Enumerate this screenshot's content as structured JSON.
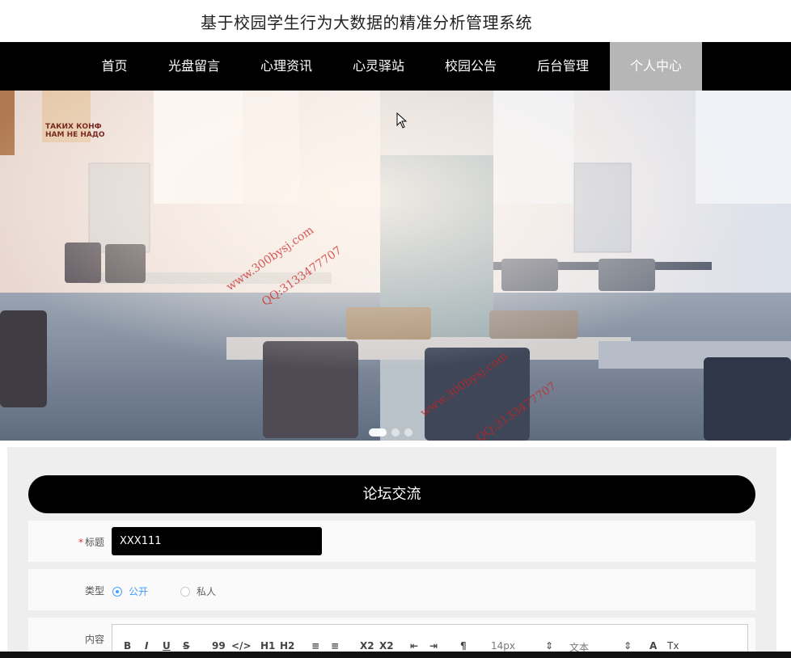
{
  "site": {
    "title": "基于校园学生行为大数据的精准分析管理系统"
  },
  "nav": {
    "items": [
      {
        "label": "首页"
      },
      {
        "label": "光盘留言"
      },
      {
        "label": "心理资讯"
      },
      {
        "label": "心灵驿站"
      },
      {
        "label": "校园公告"
      },
      {
        "label": "后台管理"
      },
      {
        "label": "个人中心"
      }
    ],
    "active_index": 6
  },
  "banner": {
    "image": "cafeteria-illustration",
    "poster_text_1": "ТАКИХ КОНФ",
    "poster_text_2": "НАМ НЕ НАДО",
    "watermarks": [
      "www.300bysj.com",
      "QQ:3133477707",
      "www.300bysj.com",
      "QQ:3133477707"
    ],
    "slide_count": 3,
    "active_slide": 0
  },
  "forum": {
    "header": "论坛交流",
    "title_label": "标题",
    "title_required": "*",
    "title_value": "XXX111",
    "type_label": "类型",
    "type_options": [
      {
        "label": "公开",
        "checked": true
      },
      {
        "label": "私人",
        "checked": false
      }
    ],
    "content_label": "内容",
    "toolbar": {
      "bold": "B",
      "italic": "I",
      "underline": "U",
      "strike": "S",
      "quote": "99",
      "code": "</>",
      "h1": "H1",
      "h2": "H2",
      "ordered_list": "≡",
      "bullet_list": "≡",
      "subscript": "X2",
      "superscript": "X2",
      "outdent": "⇤",
      "indent": "⇥",
      "direction": "¶",
      "size": "14px",
      "font": "文本",
      "color": "A",
      "clean": "Tx"
    }
  },
  "colors": {
    "nav_bg": "#000000",
    "nav_active_bg": "#b6b6b6",
    "accent": "#409eff",
    "watermark": "#cc2222"
  }
}
